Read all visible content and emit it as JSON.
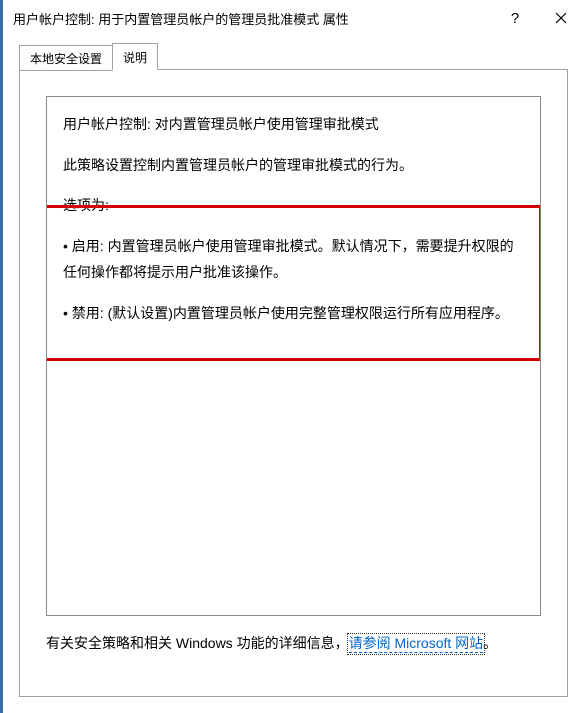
{
  "window": {
    "title": "用户帐户控制: 用于内置管理员帐户的管理员批准模式 属性"
  },
  "tabs": {
    "local": "本地安全设置",
    "explain": "说明"
  },
  "desc": {
    "heading": "用户帐户控制: 对内置管理员帐户使用管理审批模式",
    "intro": "此策略设置控制内置管理员帐户的管理审批模式的行为。",
    "options_label": "选项为:",
    "opt_enable": "• 启用: 内置管理员帐户使用管理审批模式。默认情况下，需要提升权限的任何操作都将提示用户批准该操作。",
    "opt_disable": "• 禁用: (默认设置)内置管理员帐户使用完整管理权限运行所有应用程序。"
  },
  "footer": {
    "prefix": "有关安全策略和相关 Windows 功能的详细信息，",
    "link": "请参阅 Microsoft 网站",
    "suffix": "。"
  }
}
